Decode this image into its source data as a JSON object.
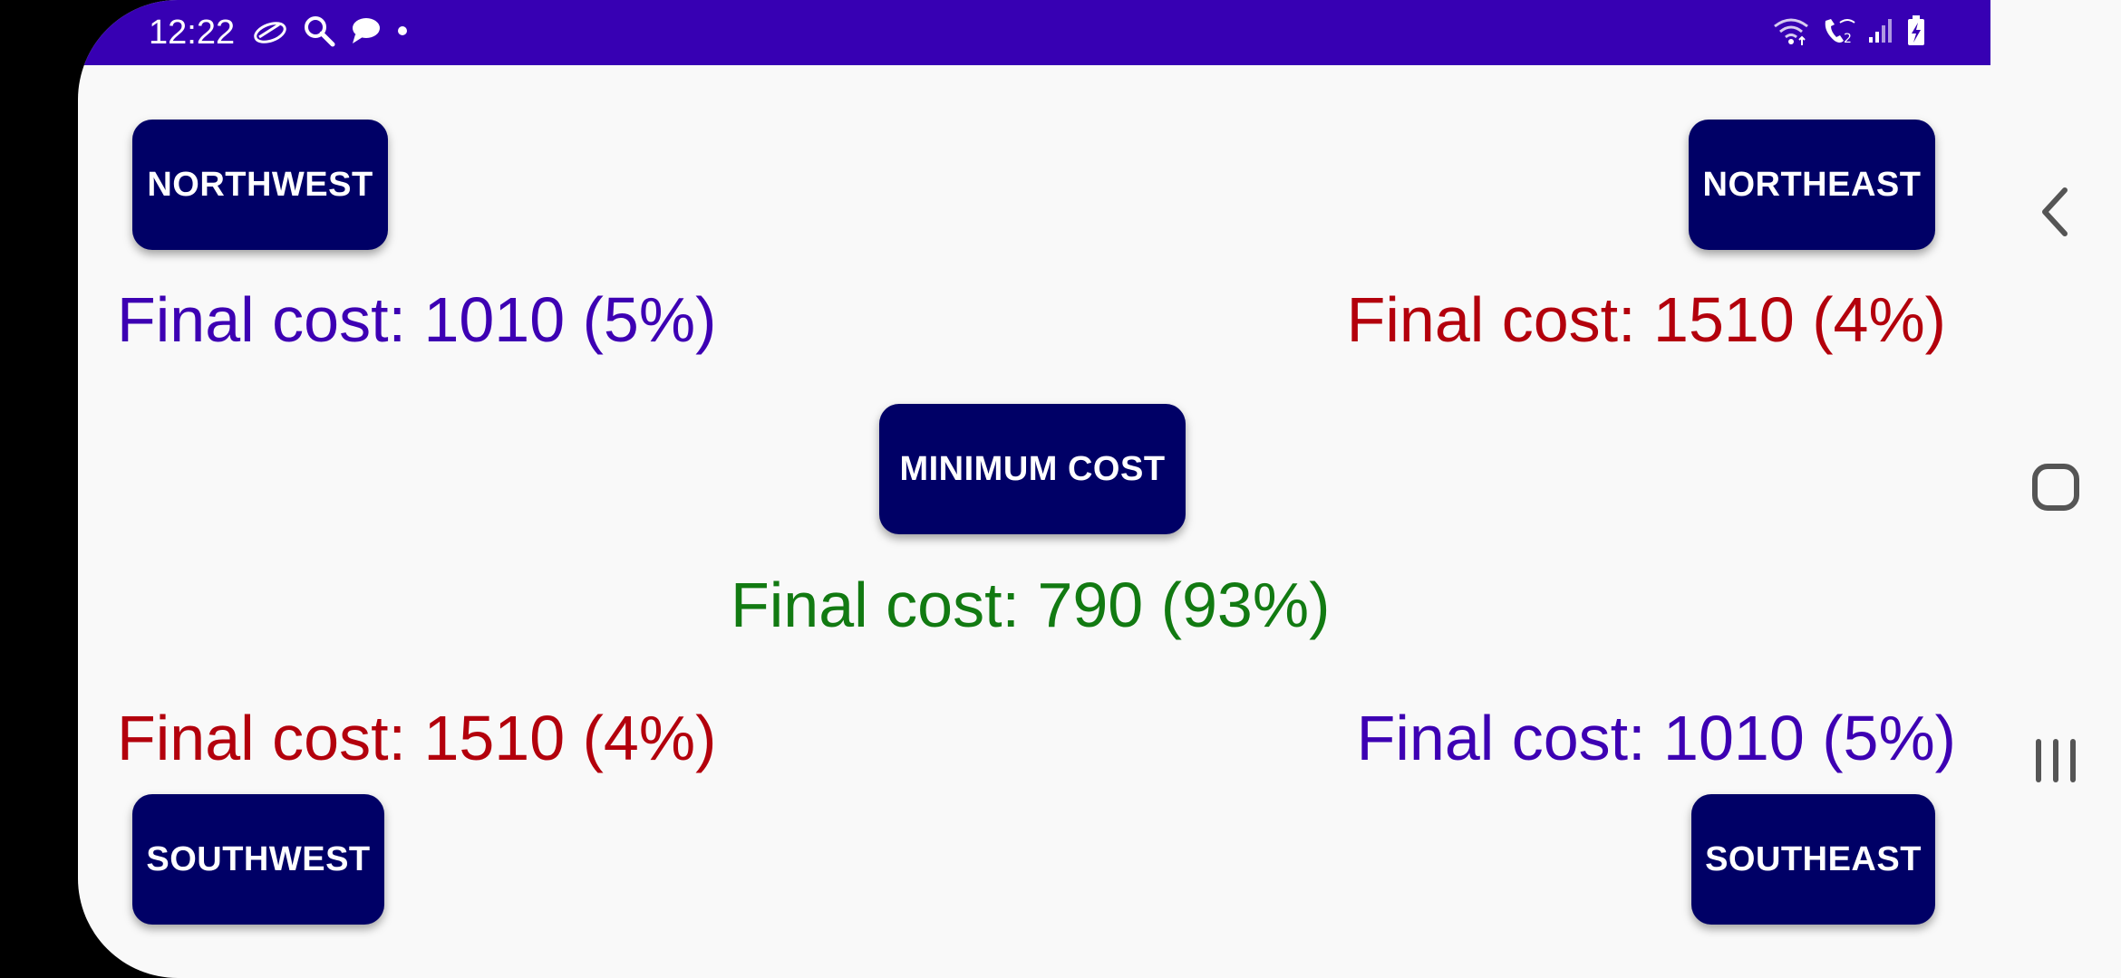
{
  "status_bar": {
    "time": "12:22",
    "left_icons": [
      "cloud-icon",
      "search-icon",
      "chat-bubble-icon",
      "dot-icon"
    ],
    "right_icons": [
      "wifi-icon",
      "wifi-calling-icon",
      "signal-icon",
      "battery-icon"
    ],
    "background": "#3700b3"
  },
  "buttons": {
    "northwest": "NORTHWEST",
    "northeast": "NORTHEAST",
    "minimum_cost": "MINIMUM COST",
    "southwest": "SOUTHWEST",
    "southeast": "SOUTHEAST",
    "background": "#000066"
  },
  "results": {
    "northwest": "Final cost: 1010 (5%)",
    "northeast": "Final cost: 1510 (4%)",
    "minimum_cost": "Final cost: 790 (93%)",
    "southwest": "Final cost: 1510 (4%)",
    "southeast": "Final cost: 1010 (5%)"
  },
  "colors": {
    "low_cost_text": "#3d00b3",
    "high_cost_text": "#b3000c",
    "best_cost_text": "#127a12"
  },
  "navigation_bar": {
    "buttons": [
      "back-icon",
      "home-icon",
      "recent-apps-icon"
    ]
  }
}
